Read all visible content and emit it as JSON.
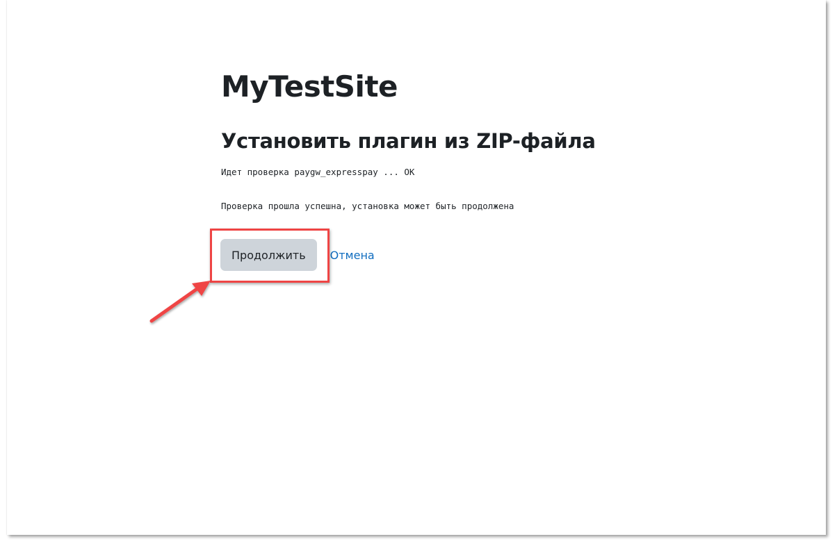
{
  "site": {
    "title": "MyTestSite"
  },
  "page": {
    "heading": "Установить плагин из ZIP-файла"
  },
  "log": {
    "lines": [
      "Идет проверка paygw_expresspay ... OK",
      "Проверка прошла успешна, установка может быть продолжена"
    ]
  },
  "actions": {
    "continue_label": "Продолжить",
    "cancel_label": "Отмена"
  },
  "colors": {
    "annotation": "#ef4444",
    "link": "#0f6cbf",
    "button_bg": "#ced4da",
    "text": "#1d2125"
  },
  "annotation": {
    "icons": [
      "highlight-box",
      "arrow-icon"
    ]
  }
}
